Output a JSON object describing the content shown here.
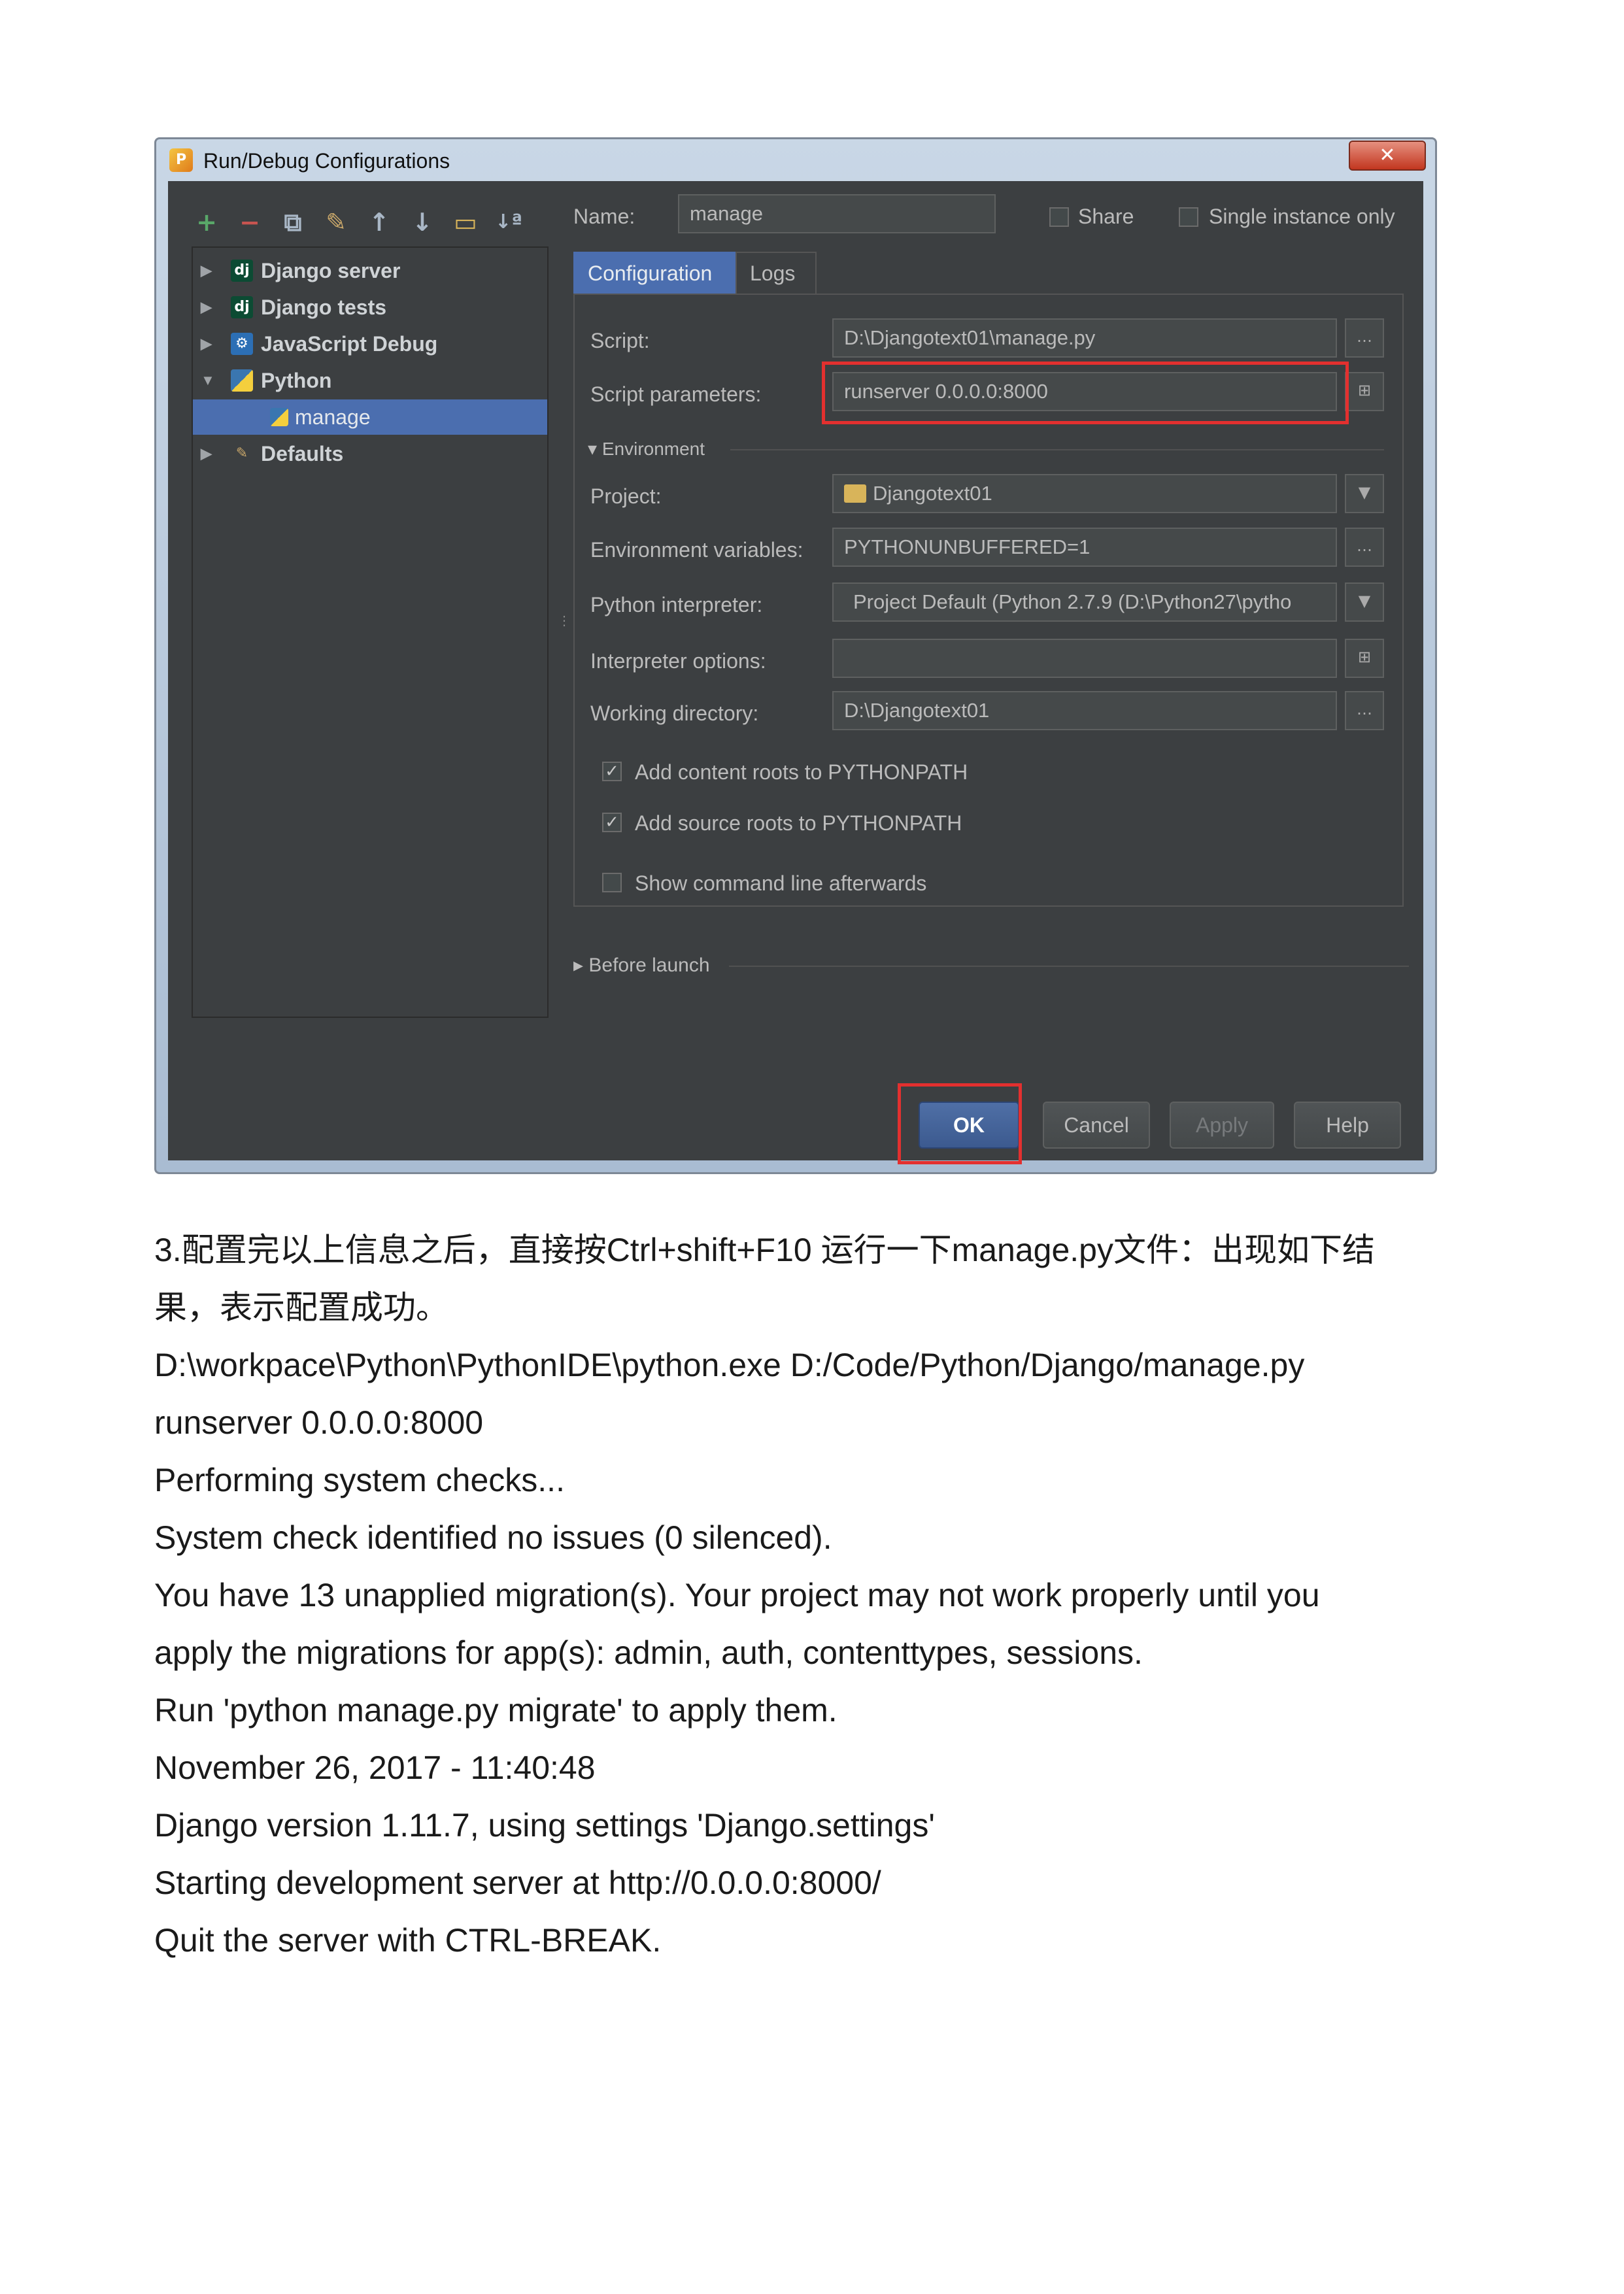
{
  "dialog": {
    "title": "Run/Debug Configurations",
    "close_label": "✕",
    "toolbar_icons": [
      "plus-icon",
      "minus-icon",
      "copy-icon",
      "wrench-icon",
      "arrow-up-icon",
      "arrow-down-icon",
      "folder-icon",
      "sort-icon"
    ],
    "tree": [
      {
        "label": "Django server",
        "icon": "dj",
        "expanded": false
      },
      {
        "label": "Django tests",
        "icon": "dj",
        "expanded": false
      },
      {
        "label": "JavaScript Debug",
        "icon": "js-debug",
        "expanded": false
      },
      {
        "label": "Python",
        "icon": "python",
        "expanded": true
      },
      {
        "label": "manage",
        "icon": "python",
        "selected": true
      },
      {
        "label": "Defaults",
        "icon": "wrench",
        "expanded": false
      }
    ],
    "name_label": "Name:",
    "name_value": "manage",
    "share_label": "Share",
    "single_instance_label": "Single instance only",
    "tabs": [
      "Configuration",
      "Logs"
    ],
    "script_label": "Script:",
    "script_value": "D:\\Djangotext01\\manage.py",
    "script_params_label": "Script parameters:",
    "script_params_value": "runserver 0.0.0.0:8000",
    "environment_label": "Environment",
    "project_label": "Project:",
    "project_value": "Djangotext01",
    "env_vars_label": "Environment variables:",
    "env_vars_value": "PYTHONUNBUFFERED=1",
    "interpreter_label": "Python interpreter:",
    "interpreter_value": "Project Default (Python 2.7.9 (D:\\Python27\\pytho",
    "interp_options_label": "Interpreter options:",
    "interp_options_value": "",
    "working_dir_label": "Working directory:",
    "working_dir_value": "D:\\Djangotext01",
    "checkboxes": [
      {
        "label": "Add content roots to PYTHONPATH",
        "checked": true
      },
      {
        "label": "Add source roots to PYTHONPATH",
        "checked": true
      },
      {
        "label": "Show command line afterwards",
        "checked": false
      }
    ],
    "before_launch_label": "Before launch",
    "buttons": {
      "ok": "OK",
      "cancel": "Cancel",
      "apply": "Apply",
      "help": "Help"
    },
    "highlight_color": "#e3302f",
    "selection_color": "#4b6eaf"
  },
  "document": {
    "lines": [
      "3.配置完以上信息之后，直接按Ctrl+shift+F10 运行一下manage.py文件：出现如下结",
      "果，表示配置成功。",
      "D:\\workpace\\Python\\PythonIDE\\python.exe D:/Code/Python/Django/manage.py",
      "runserver 0.0.0.0:8000",
      "Performing system checks...",
      "System check identified no issues (0 silenced).",
      "You have 13 unapplied migration(s). Your project may not work properly until you",
      "apply the migrations for app(s): admin, auth, contenttypes, sessions.",
      "Run 'python manage.py migrate' to apply them.",
      "November 26, 2017 - 11:40:48",
      "Django version 1.11.7, using settings 'Django.settings'",
      "Starting development server at http://0.0.0.0:8000/",
      "Quit the server with CTRL-BREAK."
    ]
  }
}
